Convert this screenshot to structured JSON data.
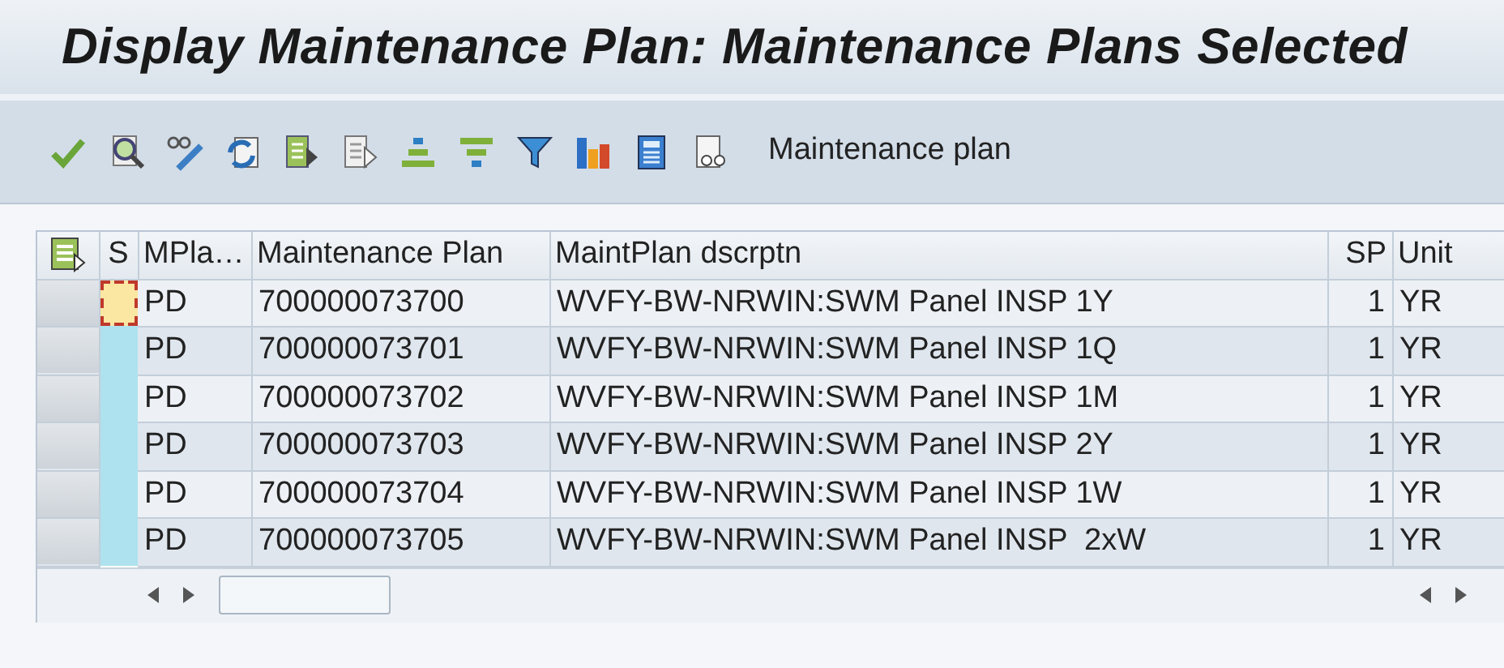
{
  "window": {
    "title": "Display Maintenance Plan: Maintenance Plans Selected"
  },
  "toolbar": {
    "button_label": "Maintenance plan"
  },
  "table": {
    "columns": [
      "S",
      "MPla…",
      "Maintenance Plan",
      "MaintPlan dscrptn",
      "SP",
      "Unit"
    ],
    "rows": [
      {
        "focused": true,
        "cells": [
          "",
          "PD",
          "700000073700",
          "WVFY-BW-NRWIN:SWM Panel INSP 1Y",
          "1",
          "YR"
        ]
      },
      {
        "focused": false,
        "cells": [
          "",
          "PD",
          "700000073701",
          "WVFY-BW-NRWIN:SWM Panel INSP 1Q",
          "1",
          "YR"
        ]
      },
      {
        "focused": false,
        "cells": [
          "",
          "PD",
          "700000073702",
          "WVFY-BW-NRWIN:SWM Panel INSP 1M",
          "1",
          "YR"
        ]
      },
      {
        "focused": false,
        "cells": [
          "",
          "PD",
          "700000073703",
          "WVFY-BW-NRWIN:SWM Panel INSP 2Y",
          "1",
          "YR"
        ]
      },
      {
        "focused": false,
        "cells": [
          "",
          "PD",
          "700000073704",
          "WVFY-BW-NRWIN:SWM Panel INSP 1W",
          "1",
          "YR"
        ]
      },
      {
        "focused": false,
        "cells": [
          "",
          "PD",
          "700000073705",
          "WVFY-BW-NRWIN:SWM Panel INSP  2xW",
          "1",
          "YR"
        ]
      }
    ]
  }
}
